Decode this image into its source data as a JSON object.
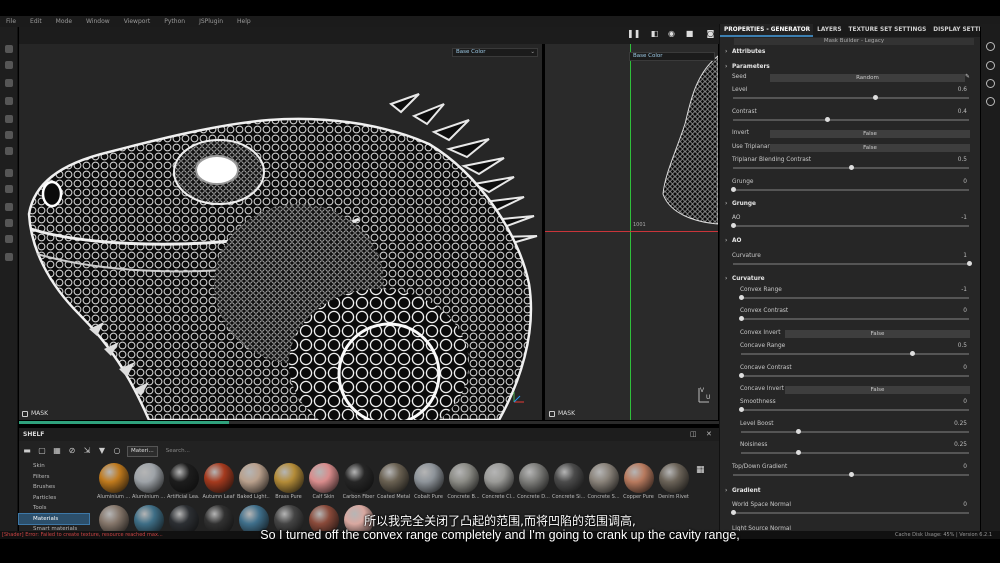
{
  "menu": [
    "File",
    "Edit",
    "Mode",
    "Window",
    "Viewport",
    "Python",
    "JSPlugin",
    "Help"
  ],
  "viewport3d": {
    "channel": "Base Color",
    "label": "MASK"
  },
  "viewport2d": {
    "channel": "Base Color",
    "label": "MASK",
    "uv_tile": "1001"
  },
  "progress": 0.3,
  "shelf": {
    "title": "SHELF",
    "filter_chip": "Materi...",
    "search_placeholder": "Search...",
    "categories": [
      {
        "label": "Skin",
        "selected": false
      },
      {
        "label": "Filters",
        "selected": false
      },
      {
        "label": "Brushes",
        "selected": false
      },
      {
        "label": "Particles",
        "selected": false
      },
      {
        "label": "Tools",
        "selected": false
      },
      {
        "label": "Materials",
        "selected": true
      },
      {
        "label": "Smart materials",
        "selected": false
      }
    ],
    "materials": [
      {
        "label": "Aluminium ...",
        "color": "#c07a1d"
      },
      {
        "label": "Aluminium ...",
        "color": "#9ea3a8"
      },
      {
        "label": "Artificial Lea...",
        "color": "#1d1d1d"
      },
      {
        "label": "Autumn Leaf",
        "color": "#a53a1e"
      },
      {
        "label": "Baked Light...",
        "color": "#b9a08c"
      },
      {
        "label": "Brass Pure",
        "color": "#b48c38"
      },
      {
        "label": "Calf Skin",
        "color": "#d98c8c"
      },
      {
        "label": "Carbon Fiber",
        "color": "#262626"
      },
      {
        "label": "Coated Metal",
        "color": "#6a6152"
      },
      {
        "label": "Cobalt Pure",
        "color": "#8e949a"
      },
      {
        "label": "Concrete B...",
        "color": "#8c8c86"
      },
      {
        "label": "Concrete Cl...",
        "color": "#9b9b98"
      },
      {
        "label": "Concrete D...",
        "color": "#7d7d7a"
      },
      {
        "label": "Concrete Si...",
        "color": "#4b4b4b"
      },
      {
        "label": "Concrete S...",
        "color": "#8a837a"
      },
      {
        "label": "Copper Pure",
        "color": "#b87a5e"
      },
      {
        "label": "Denim Rivet",
        "color": "#6b6358"
      },
      {
        "label": "",
        "color": "#85766a"
      },
      {
        "label": "",
        "color": "#3e6e86"
      },
      {
        "label": "",
        "color": "#2c2f33"
      },
      {
        "label": "",
        "color": "#313131"
      },
      {
        "label": "",
        "color": "#3f6f8b"
      },
      {
        "label": "",
        "color": "#444444"
      },
      {
        "label": "",
        "color": "#8a4a3a"
      },
      {
        "label": "",
        "color": "#d9a8a0"
      }
    ]
  },
  "panel": {
    "tabs": [
      {
        "label": "PROPERTIES - GENERATOR",
        "active": true
      },
      {
        "label": "LAYERS",
        "active": false
      },
      {
        "label": "TEXTURE SET SETTINGS",
        "active": false
      },
      {
        "label": "DISPLAY SETTINGS",
        "active": false
      }
    ],
    "generator_name": "Mask Builder - Legacy",
    "attributes_label": "Attributes",
    "parameters_label": "Parameters",
    "seed_label": "Seed",
    "seed_value": "Random",
    "grunge_section": "Grunge",
    "ao_section": "AO",
    "curvature_section": "Curvature",
    "gradient_section": "Gradient",
    "more_label": "Light Source Normal",
    "sliders": [
      {
        "label": "Level",
        "value": "0.6",
        "fraction": 0.6,
        "sub": false
      },
      {
        "label": "Contrast",
        "value": "0.4",
        "fraction": 0.4,
        "sub": false
      },
      {
        "label": "Triplanar Blending Contrast",
        "value": "0.5",
        "fraction": 0.5,
        "sub": false
      },
      {
        "label": "Grunge",
        "value": "0",
        "fraction": 0,
        "sub": false
      },
      {
        "label": "AO",
        "value": "-1",
        "fraction": 0,
        "sub": false
      },
      {
        "label": "Curvature",
        "value": "1",
        "fraction": 1,
        "sub": false
      },
      {
        "label": "Convex Range",
        "value": "-1",
        "fraction": 0,
        "sub": true
      },
      {
        "label": "Convex Contrast",
        "value": "0",
        "fraction": 0,
        "sub": true
      },
      {
        "label": "Concave Range",
        "value": "0.5",
        "fraction": 0.75,
        "sub": true
      },
      {
        "label": "Concave Contrast",
        "value": "0",
        "fraction": 0,
        "sub": true
      },
      {
        "label": "Smoothness",
        "value": "0",
        "fraction": 0,
        "sub": true
      },
      {
        "label": "Level Boost",
        "value": "0.25",
        "fraction": 0.25,
        "sub": true
      },
      {
        "label": "Noisiness",
        "value": "0.25",
        "fraction": 0.25,
        "sub": true
      },
      {
        "label": "Top/Down Gradient",
        "value": "0",
        "fraction": 0.5,
        "sub": false
      },
      {
        "label": "World Space Normal",
        "value": "0",
        "fraction": 0,
        "sub": false
      }
    ],
    "toggles": [
      {
        "label": "Invert",
        "value": "False",
        "sub": false
      },
      {
        "label": "Use Triplanar",
        "value": "False",
        "sub": false
      },
      {
        "label": "Convex Invert",
        "value": "False",
        "sub": true
      },
      {
        "label": "Concave Invert",
        "value": "False",
        "sub": true
      }
    ]
  },
  "status": {
    "error": "[Shader] Error: Failed to create texture, resource reached max...",
    "info": "Cache Disk Usage:   45%  |  Version 6.2.1"
  },
  "subtitle": {
    "zh": "所以我完全关闭了凸起的范围,而将凹陷的范围调高,",
    "en": "So I turned off the convex range completely and I'm going to crank up the cavity range,"
  }
}
